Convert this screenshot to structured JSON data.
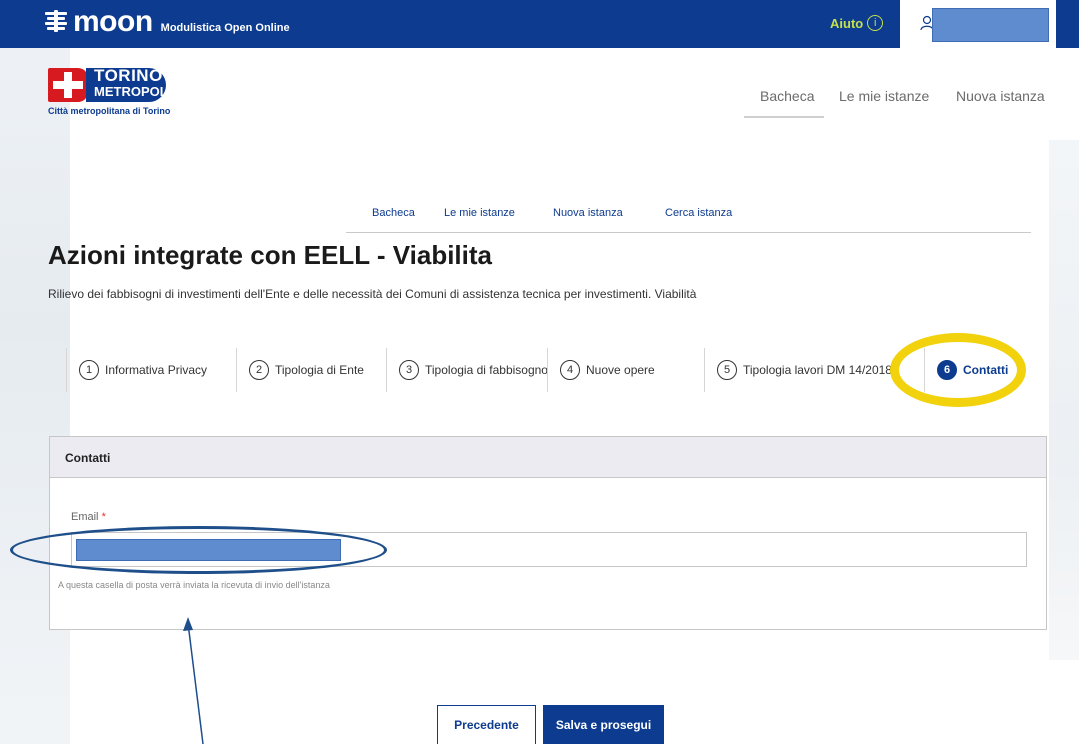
{
  "header": {
    "brand_name": "moon",
    "brand_subtitle": "Modulistica Open Online",
    "help_label": "Aiuto",
    "help_icon": "info-icon",
    "user_icon": "user-icon",
    "colors": {
      "bar": "#0c3b8f",
      "help": "#c5e04a"
    }
  },
  "logo": {
    "line1": "TORINO",
    "line2": "METROPOLI",
    "caption": "Città metropolitana di Torino"
  },
  "main_nav": {
    "items": [
      {
        "label": "Bacheca"
      },
      {
        "label": "Le mie istanze"
      },
      {
        "label": "Nuova istanza"
      }
    ]
  },
  "sub_nav": {
    "items": [
      {
        "label": "Bacheca"
      },
      {
        "label": "Le mie istanze"
      },
      {
        "label": "Nuova istanza"
      },
      {
        "label": "Cerca istanza"
      }
    ]
  },
  "page": {
    "title": "Azioni integrate con EELL - Viabilita",
    "description": "Rilievo dei fabbisogni di investimenti dell'Ente e delle necessità dei Comuni di assistenza tecnica per investimenti. Viabilità"
  },
  "steps": [
    {
      "num": "1",
      "label": "Informativa Privacy",
      "active": false
    },
    {
      "num": "2",
      "label": "Tipologia di Ente",
      "active": false
    },
    {
      "num": "3",
      "label": "Tipologia di fabbisogno",
      "active": false
    },
    {
      "num": "4",
      "label": "Nuove opere",
      "active": false
    },
    {
      "num": "5",
      "label": "Tipologia lavori DM 14/2018",
      "active": false
    },
    {
      "num": "6",
      "label": "Contatti",
      "active": true
    }
  ],
  "form": {
    "section_title": "Contatti",
    "email_label": "Email",
    "required_marker": "*",
    "email_value": "",
    "email_hint": "A questa casella di posta verrà inviata la ricevuta di invio dell'istanza"
  },
  "buttons": {
    "prev_label": "Precedente",
    "next_label": "Salva e prosegui"
  },
  "annotations": {
    "ring_color_step": "#f2d20c",
    "ring_color_input": "#1e4f8a"
  }
}
